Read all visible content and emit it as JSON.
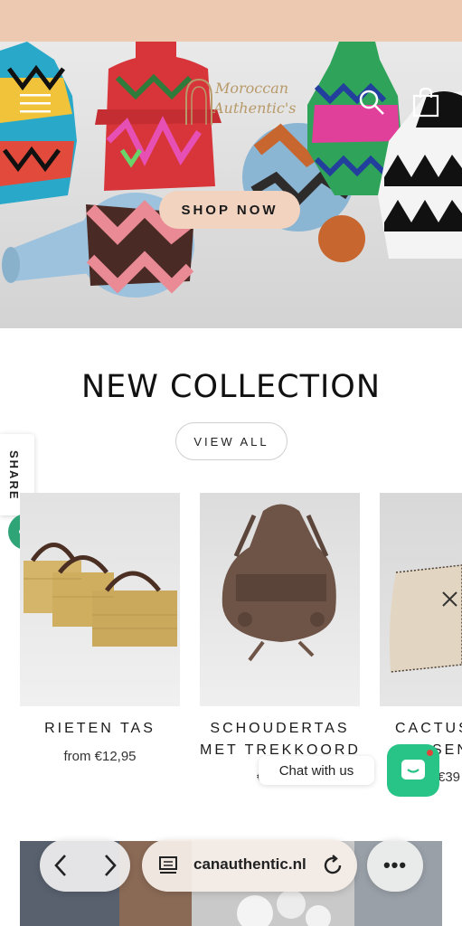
{
  "hero": {
    "logo_line1": "Moroccan",
    "logo_line2": "Authentic's",
    "shop_now_label": "SHOP NOW",
    "icons": {
      "menu": "menu-icon",
      "search": "search-icon",
      "cart": "shopping-bag-icon"
    }
  },
  "collection": {
    "title": "NEW COLLECTION",
    "view_all_label": "VIEW ALL",
    "products": [
      {
        "name": "RIETEN TAS",
        "price": "from €12,95"
      },
      {
        "name_line1": "SCHOUDERTAS",
        "name_line2": "MET TREKKOORD",
        "price": "€"
      },
      {
        "name_line1": "CACTUS",
        "name_line2": "SEN",
        "price": "€39"
      }
    ]
  },
  "share": {
    "label": "SHARE",
    "icon": "share-icon"
  },
  "chat": {
    "label": "Chat with us",
    "icon": "chat-icon"
  },
  "browser": {
    "url": "canauthentic.nl",
    "more_label": "•••",
    "icons": {
      "back": "chevron-left-icon",
      "forward": "chevron-right-icon",
      "tabs": "reader-icon",
      "reload": "reload-icon"
    }
  },
  "colors": {
    "topbar": "#edc9b2",
    "shop_button": "#f2d3bf",
    "chat_green": "#28c386",
    "share_green": "#2fa577"
  }
}
